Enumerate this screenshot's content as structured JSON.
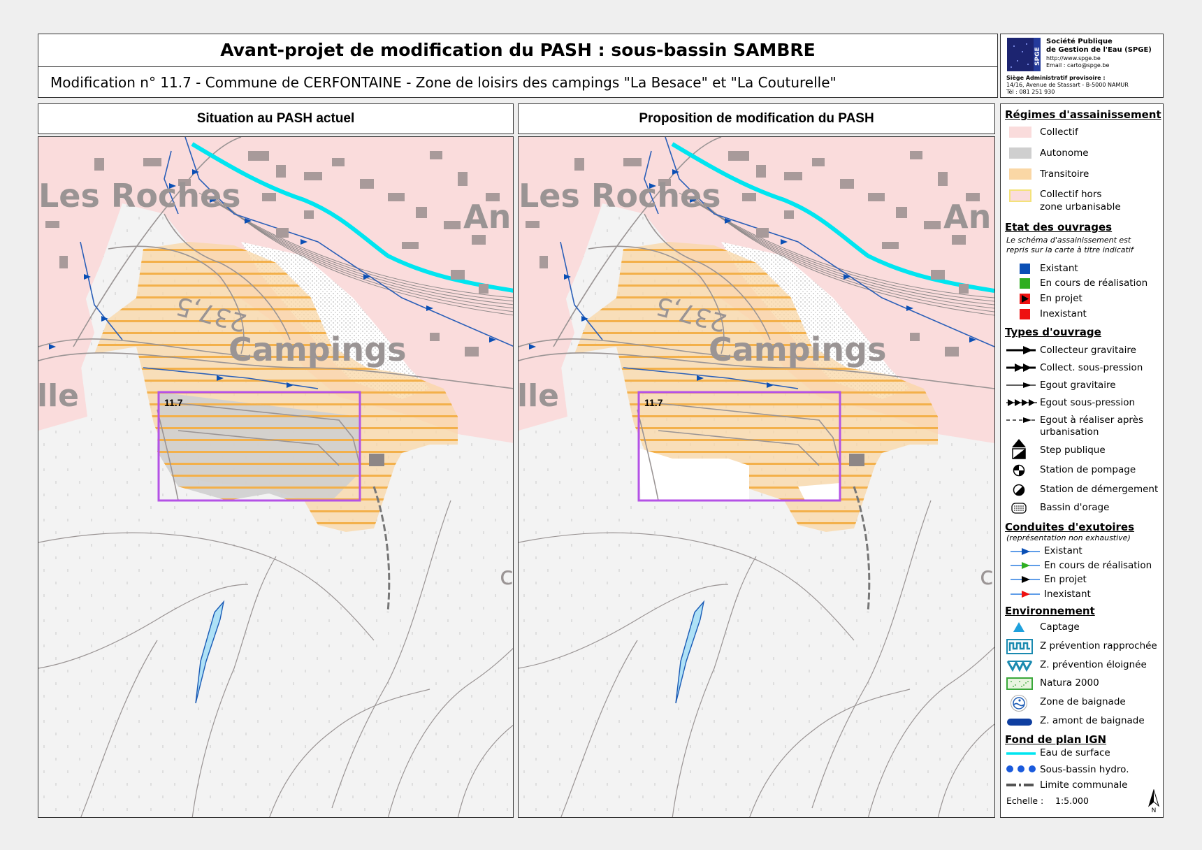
{
  "header": {
    "title": "Avant-projet de modification du PASH : sous-bassin SAMBRE",
    "subtitle": "Modification n° 11.7 - Commune de CERFONTAINE - Zone de loisirs des campings \"La Besace\" et \"La Couturelle\""
  },
  "logo": {
    "org_line1": "Société Publique",
    "org_line2": "de Gestion de l'Eau (SPGE)",
    "url": "http://www.spge.be",
    "email": "Email : carto@spge.be",
    "seat_label": "Siège Administratif provisoire :",
    "address": "14/16, Avenue de Stassart - B-5000 NAMUR",
    "phone": "Tél : 081 251 930",
    "mark_text": "SPGE"
  },
  "maps": {
    "left_title": "Situation au PASH actuel",
    "right_title": "Proposition de modification du PASH",
    "zone_label": "11.7",
    "place_roches": "Les Roches",
    "place_campings": "Campings",
    "place_an": "An",
    "place_lle": "lle",
    "elevation": "237,5",
    "place_c": "c"
  },
  "legend": {
    "regimes": {
      "title": "Régimes d'assainissement",
      "items": [
        "Collectif",
        "Autonome",
        "Transitoire",
        "Collectif hors",
        "zone urbanisable"
      ]
    },
    "etat": {
      "title": "Etat des ouvrages",
      "note1": "Le schéma d'assainissement est",
      "note2": "repris sur la carte à titre indicatif",
      "items": [
        "Existant",
        "En cours de réalisation",
        "En projet",
        "Inexistant"
      ]
    },
    "types": {
      "title": "Types d'ouvrage",
      "items": [
        "Collecteur gravitaire",
        "Collect. sous-pression",
        "Egout gravitaire",
        "Egout sous-pression",
        "Egout à réaliser après",
        "urbanisation",
        "Step publique",
        "Station de pompage",
        "Station de démergement",
        "Bassin d'orage"
      ]
    },
    "exutoires": {
      "title": "Conduites d'exutoires",
      "note": "(représentation non exhaustive)",
      "items": [
        "Existant",
        "En cours de réalisation",
        "En projet",
        "Inexistant"
      ]
    },
    "environnement": {
      "title": "Environnement",
      "items": [
        "Captage",
        "Z prévention rapprochée",
        "Z. prévention éloignée",
        "Natura 2000",
        "Zone de baignade",
        "Z. amont de baignade"
      ]
    },
    "fond": {
      "title": "Fond de plan IGN",
      "items": [
        "Eau de surface",
        "Sous-bassin hydro.",
        "Limite communale"
      ]
    },
    "scale_label": "Echelle :",
    "scale_value": "1:5.000",
    "north": "N"
  },
  "colors": {
    "collectif": "#fadcdc",
    "autonome": "#cfcfcf",
    "transitoire": "#fad7a5",
    "hatch": "#f3b04a",
    "zone_frame": "#b452e6",
    "water": "#00e5f0",
    "existant": "#0a4fb5",
    "en_cours": "#2fae21",
    "inexistant": "#e11",
    "building": "#a89a9a"
  }
}
